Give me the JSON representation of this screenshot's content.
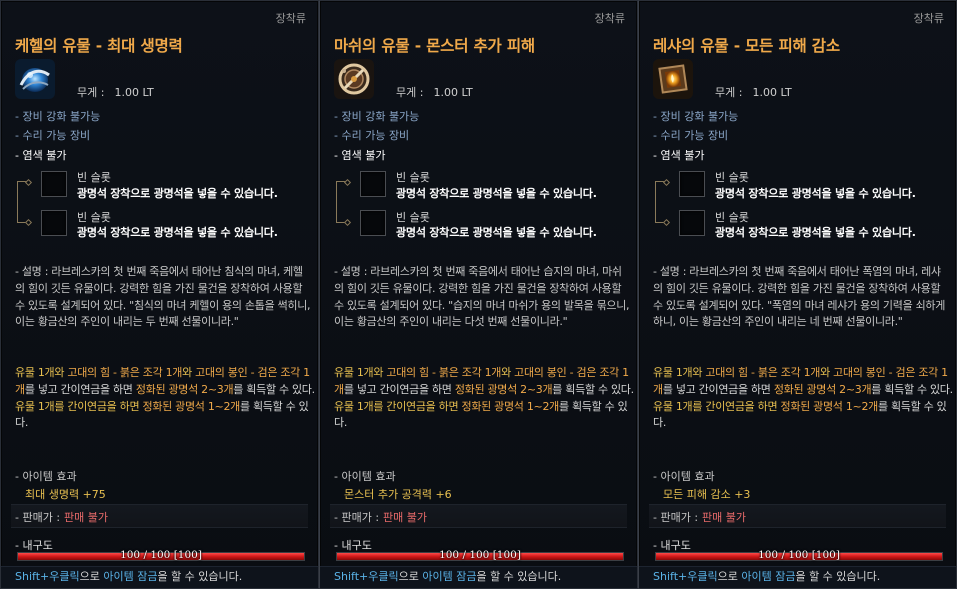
{
  "tooltips": [
    {
      "category": "장착류",
      "title": "케헬의 유물 - 최대 생명력",
      "icon": "blue-orb-relic-icon",
      "weight_label": "무게 :",
      "weight_value": "1.00 LT",
      "flags": [
        "- 장비 강화 불가능",
        "- 수리 가능 장비",
        "- 염색 불가"
      ],
      "sockets": [
        {
          "title": "빈 슬롯",
          "desc": "광명석 장착으로 광명석을 넣을 수 있습니다."
        },
        {
          "title": "빈 슬롯",
          "desc": "광명석 장착으로 광명석을 넣을 수 있습니다."
        }
      ],
      "description": "- 설명 : 라브레스카의 첫 번째 죽음에서 태어난 침식의 마녀, 케헬의 힘이 깃든 유물이다. 강력한 힘을 가진 물건을 장착하여 사용할 수 있도록 설계되어 있다. \"침식의 마녀 케헬이 용의 손톱을 썩히니, 이는 황금산의 주인이 내리는 두 번째 선물이니라.\"",
      "recipe": {
        "a1": "유물 1개와 ",
        "a2": "고대의 힘 - 붉은 조각 1개",
        "a3": "와 ",
        "a4": "고대의 봉인 - 검은 조각 1개",
        "a5": "를 넣고 간이연금을 하면 ",
        "a6": "정화된 광명석 2~3개",
        "a7": "를 획득할 수 있다.",
        "b1": "유물 1개를 간이연금을 하면 ",
        "b2": "정화된 광명석 1~2개",
        "b3": "를 획득할 수 있다."
      },
      "effect_label": "- 아이템 효과",
      "effect_value": "최대 생명력 +75",
      "sell_label": "- 판매가 :",
      "sell_value": "판매 불가",
      "durability_label": "- 내구도",
      "durability_text": "100 / 100 [100]",
      "durability_fraction": 1.0,
      "footer": {
        "part1": "Shift+우클릭",
        "part2": "으로 ",
        "part3": "아이템 잠금",
        "part4": "을 할 수 있습니다."
      }
    },
    {
      "category": "장착류",
      "title": "마쉬의 유물 - 몬스터 추가 피해",
      "icon": "bronze-compass-relic-icon",
      "weight_label": "무게 :",
      "weight_value": "1.00 LT",
      "flags": [
        "- 장비 강화 불가능",
        "- 수리 가능 장비",
        "- 염색 불가"
      ],
      "sockets": [
        {
          "title": "빈 슬롯",
          "desc": "광명석 장착으로 광명석을 넣을 수 있습니다."
        },
        {
          "title": "빈 슬롯",
          "desc": "광명석 장착으로 광명석을 넣을 수 있습니다."
        }
      ],
      "description": "- 설명 : 라브레스카의 첫 번째 죽음에서 태어난 습지의 마녀, 마쉬의 힘이 깃든 유물이다. 강력한 힘을 가진 물건을 장착하여 사용할 수 있도록 설계되어 있다. \"습지의 마녀 마쉬가 용의 발목을 묶으니, 이는 황금산의 주인이 내리는 다섯 번째 선물이니라.\"",
      "recipe": {
        "a1": "유물 1개와 ",
        "a2": "고대의 힘 - 붉은 조각 1개",
        "a3": "와 ",
        "a4": "고대의 봉인 - 검은 조각 1개",
        "a5": "를 넣고 간이연금을 하면 ",
        "a6": "정화된 광명석 2~3개",
        "a7": "를 획득할 수 있다.",
        "b1": "유물 1개를 간이연금을 하면 ",
        "b2": "정화된 광명석 1~2개",
        "b3": "를 획득할 수 있다."
      },
      "effect_label": "- 아이템 효과",
      "effect_value": "몬스터 추가 공격력 +6",
      "sell_label": "- 판매가 :",
      "sell_value": "판매 불가",
      "durability_label": "- 내구도",
      "durability_text": "100 / 100 [100]",
      "durability_fraction": 1.0,
      "footer": {
        "part1": "Shift+우클릭",
        "part2": "으로 ",
        "part3": "아이템 잠금",
        "part4": "을 할 수 있습니다."
      }
    },
    {
      "category": "장착류",
      "title": "레샤의 유물 - 모든 피해 감소",
      "icon": "golden-lantern-relic-icon",
      "weight_label": "무게 :",
      "weight_value": "1.00 LT",
      "flags": [
        "- 장비 강화 불가능",
        "- 수리 가능 장비",
        "- 염색 불가"
      ],
      "sockets": [
        {
          "title": "빈 슬롯",
          "desc": "광명석 장착으로 광명석을 넣을 수 있습니다."
        },
        {
          "title": "빈 슬롯",
          "desc": "광명석 장착으로 광명석을 넣을 수 있습니다."
        }
      ],
      "description": "- 설명 : 라브레스카의 첫 번째 죽음에서 태어난 폭염의 마녀, 레샤의 힘이 깃든 유물이다. 강력한 힘을 가진 물건을 장착하여 사용할 수 있도록 설계되어 있다. \"폭염의 마녀 레샤가 용의 기력을 쇠하게 하니, 이는 황금산의 주인이 내리는 네 번째 선물이니라.\"",
      "recipe": {
        "a1": "유물 1개와 ",
        "a2": "고대의 힘 - 붉은 조각 1개",
        "a3": "와 ",
        "a4": "고대의 봉인 - 검은 조각 1개",
        "a5": "를 넣고 간이연금을 하면 ",
        "a6": "정화된 광명석 2~3개",
        "a7": "를 획득할 수 있다.",
        "b1": "유물 1개를 간이연금을 하면 ",
        "b2": "정화된 광명석 1~2개",
        "b3": "를 획득할 수 있다."
      },
      "effect_label": "- 아이템 효과",
      "effect_value": "모든 피해 감소 +3",
      "sell_label": "- 판매가 :",
      "sell_value": "판매 불가",
      "durability_label": "- 내구도",
      "durability_text": "100 / 100 [100]",
      "durability_fraction": 1.0,
      "footer": {
        "part1": "Shift+우클릭",
        "part2": "으로 ",
        "part3": "아이템 잠금",
        "part4": "을 할 수 있습니다."
      }
    }
  ]
}
